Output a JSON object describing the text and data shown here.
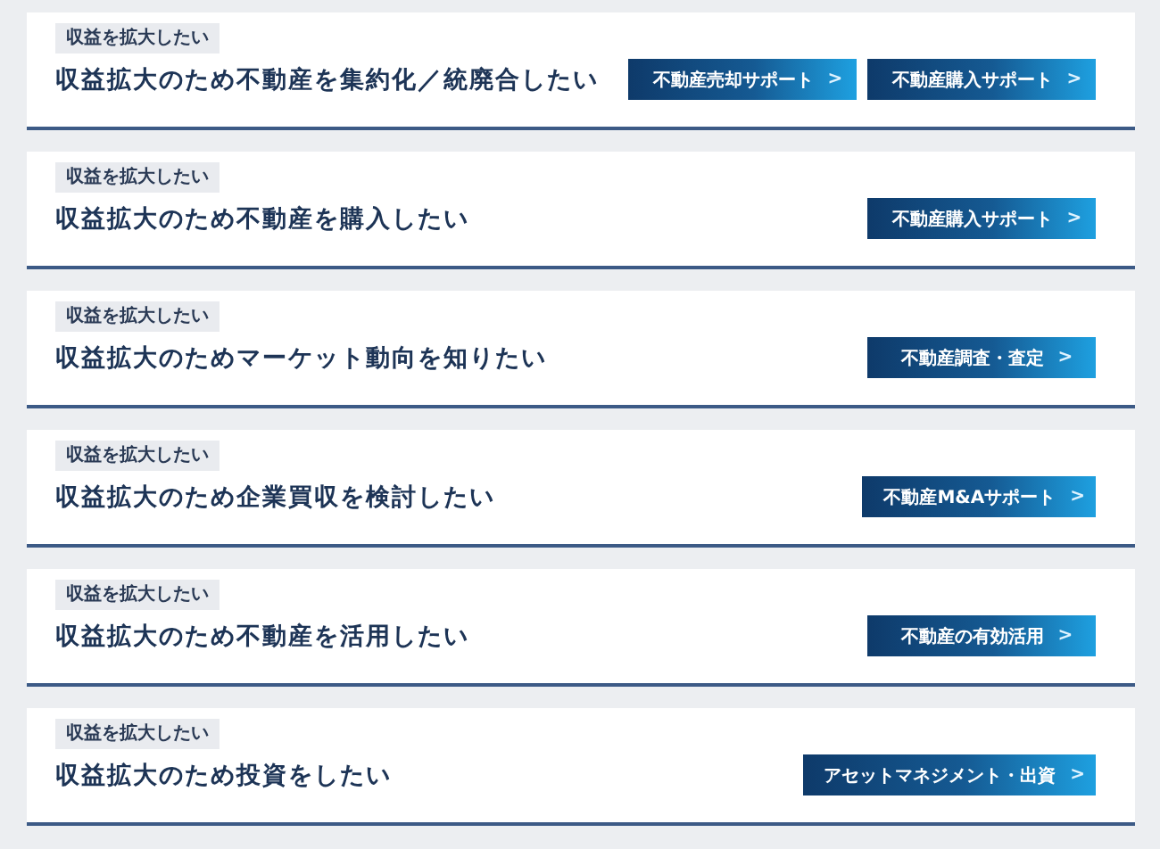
{
  "cards": [
    {
      "tag": "収益を拡大したい",
      "title": "収益拡大のため不動産を集約化／統廃合したい",
      "buttons": [
        {
          "label": "不動産売却サポート",
          "arrow": ">"
        },
        {
          "label": "不動産購入サポート",
          "arrow": ">"
        }
      ]
    },
    {
      "tag": "収益を拡大したい",
      "title": "収益拡大のため不動産を購入したい",
      "buttons": [
        {
          "label": "不動産購入サポート",
          "arrow": ">"
        }
      ]
    },
    {
      "tag": "収益を拡大したい",
      "title": "収益拡大のためマーケット動向を知りたい",
      "buttons": [
        {
          "label": "不動産調査・査定",
          "arrow": ">"
        }
      ]
    },
    {
      "tag": "収益を拡大したい",
      "title": "収益拡大のため企業買収を検討したい",
      "buttons": [
        {
          "label": "不動産M&Aサポート",
          "arrow": ">"
        }
      ]
    },
    {
      "tag": "収益を拡大したい",
      "title": "収益拡大のため不動産を活用したい",
      "buttons": [
        {
          "label": "不動産の有効活用",
          "arrow": ">"
        }
      ]
    },
    {
      "tag": "収益を拡大したい",
      "title": "収益拡大のため投資をしたい",
      "buttons": [
        {
          "label": "アセットマネジメント・出資",
          "arrow": ">"
        }
      ]
    }
  ]
}
